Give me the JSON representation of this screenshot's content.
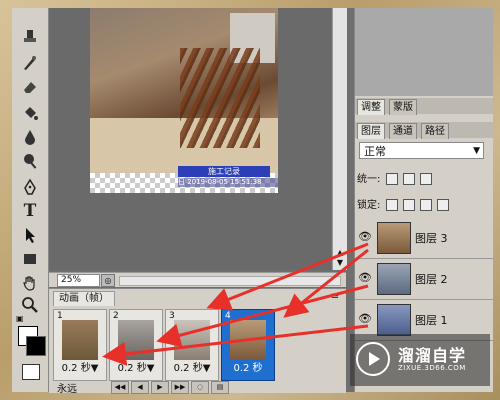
{
  "canvas": {
    "zoom": "25%",
    "stamp_title": "施工记录",
    "stamp_line": "日    2019-08-05 15:51:38"
  },
  "animation": {
    "tab_label": "动画（帧）",
    "frames": [
      {
        "num": "1",
        "delay": "0.2 秒▼",
        "color": "#6b5a3a"
      },
      {
        "num": "2",
        "delay": "0.2 秒▼",
        "color": "#8c8a86"
      },
      {
        "num": "3",
        "delay": "0.2 秒▼",
        "color": "#9a9088"
      },
      {
        "num": "4",
        "delay": "0.2 秒",
        "color": "#7b5a3c"
      }
    ],
    "loop": "永远"
  },
  "panels": {
    "top_tabs": [
      "调整",
      "蒙版"
    ],
    "layer_tabs": [
      "图层",
      "通道",
      "路径"
    ],
    "blend_mode": "正常",
    "unify_label": "统一:",
    "lock_label": "锁定:",
    "layers": [
      {
        "name": "图层 3",
        "color": "#7a5a3a"
      },
      {
        "name": "图层 2",
        "color": "#5d6a80"
      },
      {
        "name": "图层 1",
        "color": "#4a5d8a"
      }
    ]
  },
  "watermark": {
    "name": "溜溜自学",
    "url": "ZIXUE.3D66.COM"
  },
  "colors": {
    "selected_frame": "#1e6fd0",
    "arrow": "#e8302a"
  }
}
